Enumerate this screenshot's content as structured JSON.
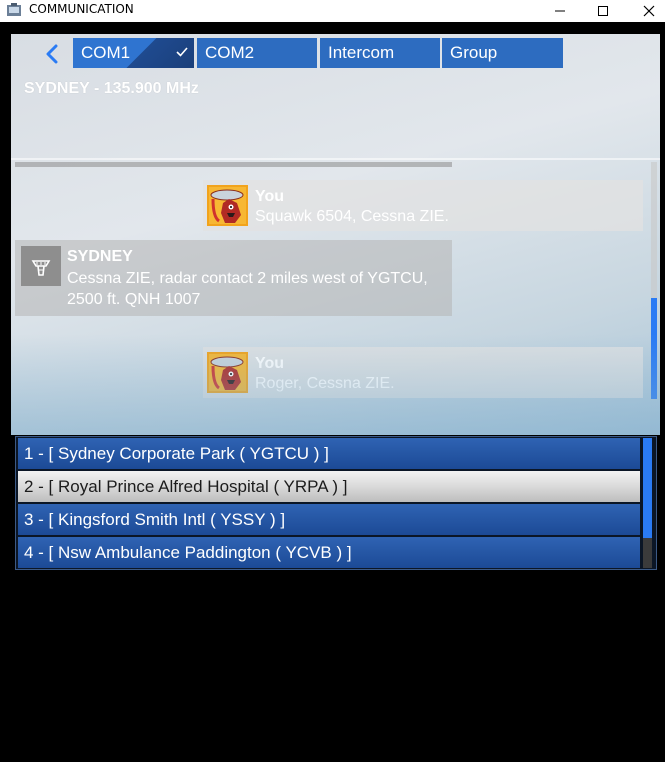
{
  "window": {
    "title": "COMMUNICATION"
  },
  "comm": {
    "tabs": [
      {
        "label": "COM1",
        "selected": true
      },
      {
        "label": "COM2",
        "selected": false
      },
      {
        "label": "Intercom",
        "selected": false
      },
      {
        "label": "Group",
        "selected": false
      }
    ],
    "frequency": "SYDNEY - 135.900 MHz",
    "messages": [
      {
        "sender": "You",
        "text": "Squawk 6504, Cessna ZIE."
      },
      {
        "sender": "SYDNEY",
        "text": "Cessna ZIE, radar contact 2 miles west of YGTCU, 2500 ft. QNH 1007"
      },
      {
        "sender": "You",
        "text": "Roger, Cessna ZIE."
      }
    ]
  },
  "destinations": [
    {
      "label": "1 - [ Sydney Corporate Park ( YGTCU ) ]",
      "selected": false
    },
    {
      "label": "2 - [ Royal Prince Alfred Hospital ( YRPA ) ]",
      "selected": true
    },
    {
      "label": "3 - [ Kingsford Smith Intl ( YSSY ) ]",
      "selected": false
    },
    {
      "label": "4 - [ Nsw Ambulance Paddington ( YCVB ) ]",
      "selected": false
    }
  ],
  "icons": {
    "app": "app-icon",
    "back": "chevron-left-icon",
    "check": "check-icon",
    "atc": "control-tower-icon",
    "avatar": "pilot-avatar-icon"
  },
  "colors": {
    "tab": "#2d6cc0",
    "accent": "#2a7bf4",
    "list_item": "#1c4a96"
  }
}
